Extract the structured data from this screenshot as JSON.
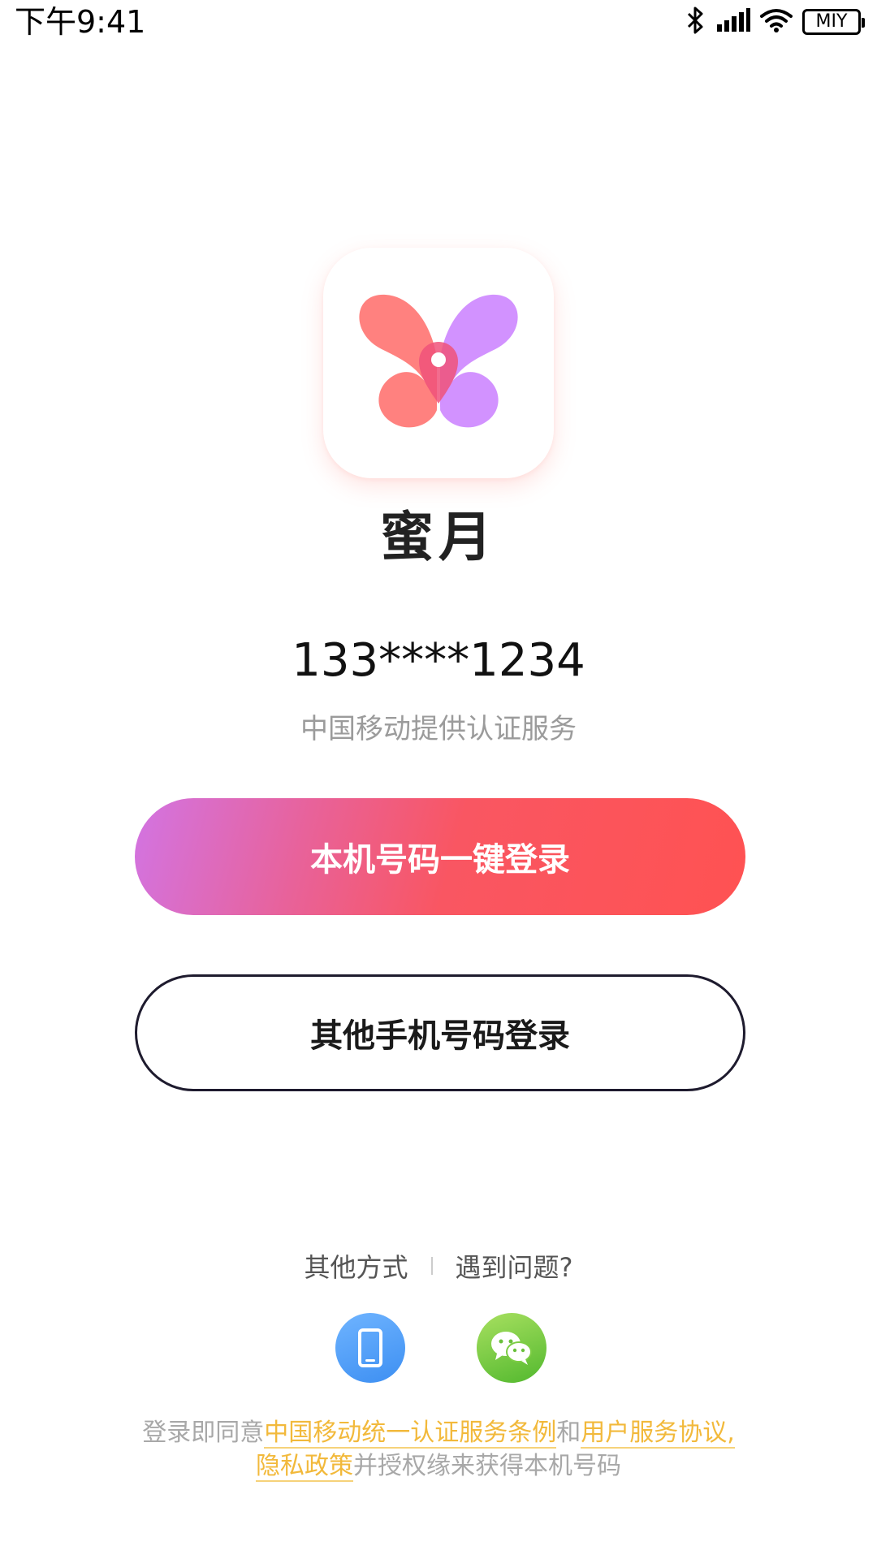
{
  "status_bar": {
    "time": "下午9:41",
    "carrier_badge": "MIY",
    "icons": [
      "bluetooth-icon",
      "signal-icon",
      "wifi-icon",
      "battery-icon"
    ]
  },
  "app": {
    "name": "蜜月",
    "logo_icon": "butterfly-location-logo",
    "colors": {
      "left_wing": "#ff7a78",
      "right_wing": "#d08cff",
      "pin": "#f0527a"
    }
  },
  "login": {
    "phone_number": "133****1234",
    "provider_text": "中国移动提供认证服务",
    "primary_button_label": "本机号码一键登录",
    "secondary_button_label": "其他手机号码登录",
    "primary_gradient": [
      "#d274e3",
      "#ff5252"
    ]
  },
  "other_options": {
    "other_methods_label": "其他方式",
    "help_label": "遇到问题?",
    "social": [
      {
        "name": "phone-login",
        "icon": "mobile-phone-icon",
        "color": "#4f9df7"
      },
      {
        "name": "wechat-login",
        "icon": "wechat-icon",
        "color": "#7ccd44"
      }
    ]
  },
  "agreement": {
    "prefix": "登录即同意",
    "link_cmcc": "中国移动统一认证服务条例",
    "conj": "和",
    "link_user": "用户服务协议,",
    "link_privacy": "隐私政策",
    "suffix": "并授权缘来获得本机号码",
    "link_color": "#f2b93b"
  }
}
